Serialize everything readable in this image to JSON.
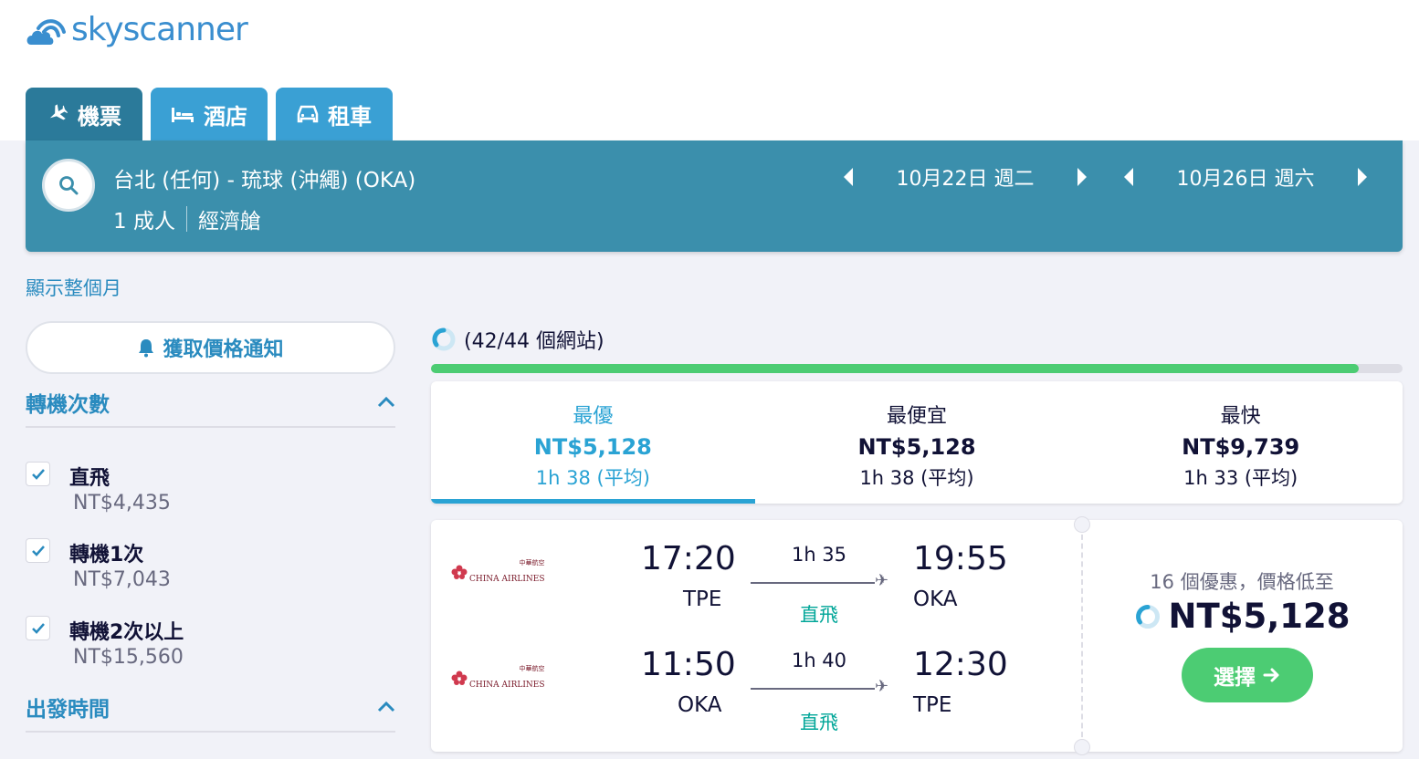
{
  "brand": {
    "name": "skyscanner",
    "color": "#3a8ecf"
  },
  "tabs": [
    {
      "label": "機票",
      "icon": "plane-icon",
      "active": true
    },
    {
      "label": "酒店",
      "icon": "bed-icon",
      "active": false
    },
    {
      "label": "租車",
      "icon": "car-icon",
      "active": false
    }
  ],
  "search": {
    "route": "台北 (任何) - 琉球 (沖繩) (OKA)",
    "passengers": "1 成人",
    "cabin": "經濟艙",
    "depart_date": "10月22日 週二",
    "return_date": "10月26日 週六"
  },
  "sidebar": {
    "month_link": "顯示整個月",
    "price_alert": "獲取價格通知",
    "stops_title": "轉機次數",
    "stops": [
      {
        "label": "直飛",
        "price": "NT$4,435",
        "checked": true
      },
      {
        "label": "轉機1次",
        "price": "NT$7,043",
        "checked": true
      },
      {
        "label": "轉機2次以上",
        "price": "NT$15,560",
        "checked": true
      }
    ],
    "departure_title": "出發時間"
  },
  "progress": {
    "text": "(42/44 個網站)",
    "fraction": 0.955,
    "color": "#4ccc73"
  },
  "sort_tabs": [
    {
      "title": "最優",
      "price": "NT$5,128",
      "duration": "1h 38 (平均)",
      "active": true
    },
    {
      "title": "最便宜",
      "price": "NT$5,128",
      "duration": "1h 38 (平均)",
      "active": false
    },
    {
      "title": "最快",
      "price": "NT$9,739",
      "duration": "1h 33 (平均)",
      "active": false
    }
  ],
  "result": {
    "airline": "CHINA AIRLINES",
    "airline_zh": "中華航空",
    "outbound": {
      "dep_time": "17:20",
      "dep_code": "TPE",
      "duration": "1h 35",
      "stops": "直飛",
      "arr_time": "19:55",
      "arr_code": "OKA"
    },
    "inbound": {
      "dep_time": "11:50",
      "dep_code": "OKA",
      "duration": "1h 40",
      "stops": "直飛",
      "arr_time": "12:30",
      "arr_code": "TPE"
    },
    "deals_text": "16 個優惠，價格低至",
    "price": "NT$5,128",
    "select_label": "選擇"
  }
}
